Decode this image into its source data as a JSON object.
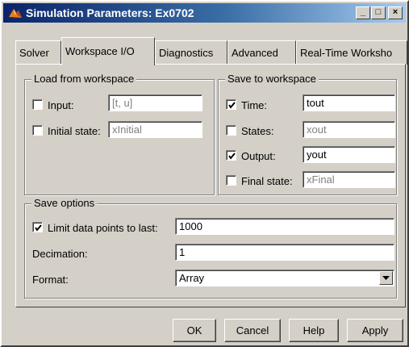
{
  "window": {
    "title": "Simulation Parameters: Ex0702",
    "minimize": "_",
    "maximize": "□",
    "close": "×"
  },
  "tabs": [
    {
      "label": "Solver"
    },
    {
      "label": "Workspace I/O"
    },
    {
      "label": "Diagnostics"
    },
    {
      "label": "Advanced"
    },
    {
      "label": "Real-Time Worksho"
    }
  ],
  "load": {
    "legend": "Load from workspace",
    "input": {
      "label": "Input:",
      "value": "[t, u]",
      "checked": false
    },
    "initial_state": {
      "label": "Initial state:",
      "value": "xInitial",
      "checked": false
    }
  },
  "save": {
    "legend": "Save to workspace",
    "time": {
      "label": "Time:",
      "value": "tout",
      "checked": true
    },
    "states": {
      "label": "States:",
      "value": "xout",
      "checked": false
    },
    "output": {
      "label": "Output:",
      "value": "yout",
      "checked": true
    },
    "final_state": {
      "label": "Final state:",
      "value": "xFinal",
      "checked": false
    }
  },
  "options": {
    "legend": "Save options",
    "limit": {
      "label": "Limit data points to last:",
      "value": "1000",
      "checked": true
    },
    "decimation": {
      "label": "Decimation:",
      "value": "1"
    },
    "format": {
      "label": "Format:",
      "value": "Array"
    }
  },
  "buttons": {
    "ok": "OK",
    "cancel": "Cancel",
    "help": "Help",
    "apply": "Apply"
  }
}
